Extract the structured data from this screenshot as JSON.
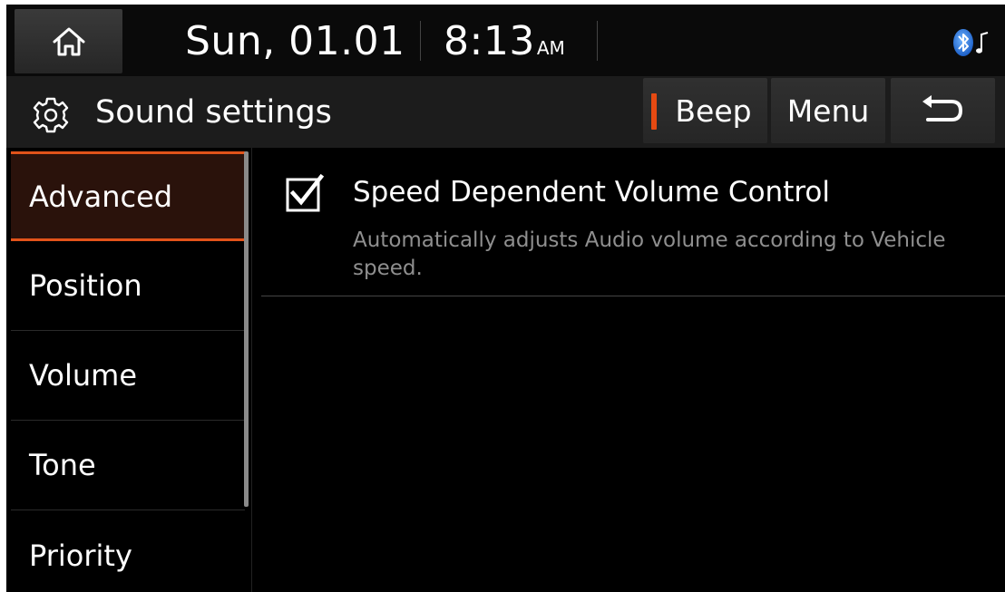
{
  "status_bar": {
    "date": "Sun, 01.01",
    "time": "8:13",
    "ampm": "AM",
    "bluetooth_audio_icon": "bluetooth-audio-icon"
  },
  "title_bar": {
    "title": "Sound settings",
    "title_icon": "gear-icon",
    "beep_label": "Beep",
    "menu_label": "Menu",
    "back_icon": "back-arrow-icon"
  },
  "side_menu": {
    "items": [
      {
        "label": "Advanced",
        "active": true
      },
      {
        "label": "Position",
        "active": false
      },
      {
        "label": "Volume",
        "active": false
      },
      {
        "label": "Tone",
        "active": false
      },
      {
        "label": "Priority",
        "active": false
      }
    ]
  },
  "content": {
    "options": [
      {
        "title": "Speed Dependent Volume Control",
        "description": "Automatically adjusts Audio volume according to Vehicle speed.",
        "checked": true
      }
    ]
  },
  "colors": {
    "accent": "#e2531a",
    "background": "#000000",
    "text": "#ffffff",
    "subtext": "#8f8f8f"
  }
}
